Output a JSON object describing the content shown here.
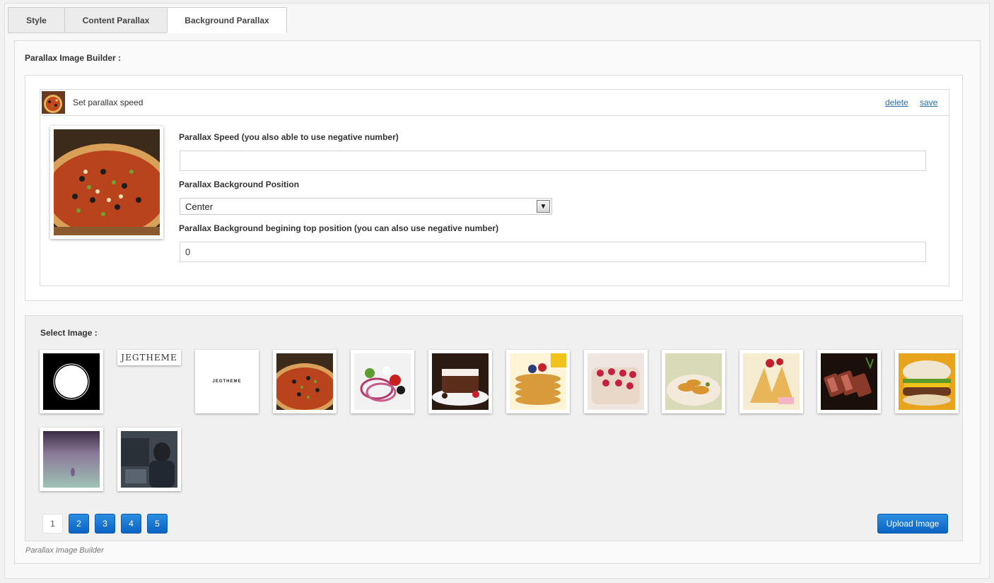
{
  "tabs": [
    {
      "label": "Style"
    },
    {
      "label": "Content Parallax"
    },
    {
      "label": "Background Parallax"
    }
  ],
  "builder": {
    "title": "Parallax Image Builder :",
    "item": {
      "title": "Set parallax speed",
      "delete_label": "delete",
      "save_label": "save",
      "speed_label": "Parallax Speed (you also able to use negative number)",
      "speed_value": "",
      "position_label": "Parallax Background Position",
      "position_value": "Center",
      "top_label": "Parallax Background begining top position (you can also use negative number)",
      "top_value": "0"
    }
  },
  "select_image": {
    "title": "Select Image :",
    "images": [
      {
        "name": "circle-logo"
      },
      {
        "name": "jegtheme-script-logo",
        "text": "JEGTHEME"
      },
      {
        "name": "jegtheme-small-logo",
        "text": "JEGTHEME"
      },
      {
        "name": "pizza"
      },
      {
        "name": "salad"
      },
      {
        "name": "chocolate-cake"
      },
      {
        "name": "pancakes"
      },
      {
        "name": "raspberry-cake"
      },
      {
        "name": "pasta"
      },
      {
        "name": "crepes"
      },
      {
        "name": "steak"
      },
      {
        "name": "burger"
      },
      {
        "name": "purple-blur"
      },
      {
        "name": "man-at-computer"
      }
    ],
    "pages": [
      "1",
      "2",
      "3",
      "4",
      "5"
    ],
    "upload_label": "Upload Image"
  },
  "footer_note": "Parallax Image Builder"
}
